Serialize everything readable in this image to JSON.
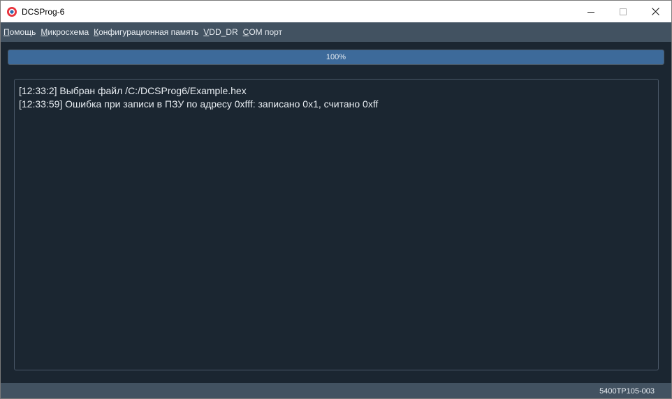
{
  "window": {
    "title": "DCSProg-6"
  },
  "menu": {
    "items": [
      {
        "accel": "П",
        "rest": "омощь"
      },
      {
        "accel": "М",
        "rest": "икросхема"
      },
      {
        "accel": "К",
        "rest": "онфигурационная память"
      },
      {
        "accel": "V",
        "rest": "DD_DR"
      },
      {
        "accel": "C",
        "rest": "OM порт"
      }
    ]
  },
  "progress": {
    "value": 100,
    "label": "100%"
  },
  "log": {
    "lines": [
      "[12:33:2] Выбран файл /C:/DCSProg6/Example.hex",
      "[12:33:59] Ошибка при записи в ПЗУ по адресу 0xfff: записано 0x1, считано 0xff"
    ]
  },
  "status": {
    "chip": "5400ТР105-003"
  },
  "colors": {
    "background": "#1b2631",
    "menubar": "#425261",
    "progress_fill": "#3d6a9a",
    "text": "#e8edf2",
    "app_icon_red": "#e8323c",
    "app_icon_blue": "#2b6cb0"
  },
  "icons": {
    "app": "app-logo-icon",
    "minimize": "minimize-icon",
    "maximize": "maximize-icon",
    "close": "close-icon"
  }
}
